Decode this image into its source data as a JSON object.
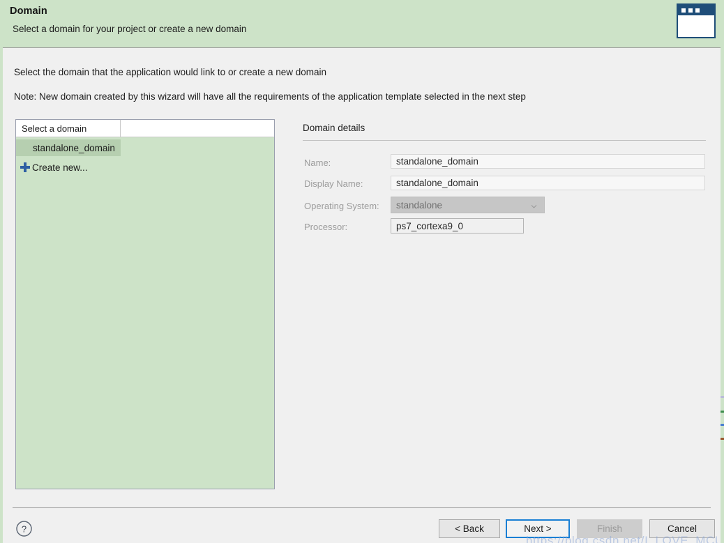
{
  "header": {
    "title": "Domain",
    "subtitle": "Select a domain for your project or create a new domain",
    "icon": "wizard-window-icon"
  },
  "instructions": {
    "line1": "Select the domain that the application would link to or create a new domain",
    "line2": "Note: New domain created by this wizard will have all the requirements of the application template selected in the next step"
  },
  "domain_list": {
    "columns": [
      "Select a domain",
      ""
    ],
    "rows": [
      {
        "label": "standalone_domain",
        "selected": true
      },
      {
        "label": "Create new...",
        "icon": "plus-icon",
        "selected": false
      }
    ]
  },
  "details": {
    "title": "Domain details",
    "fields": [
      {
        "label": "Name:",
        "value": "standalone_domain",
        "type": "text",
        "enabled": true
      },
      {
        "label": "Display Name:",
        "value": "standalone_domain",
        "type": "text",
        "enabled": true
      },
      {
        "label": "Operating System:",
        "value": "standalone",
        "type": "combo",
        "enabled": false
      },
      {
        "label": "Processor:",
        "value": "ps7_cortexa9_0",
        "type": "text",
        "enabled": true
      }
    ]
  },
  "footer": {
    "help_icon": "question-mark-icon",
    "buttons": [
      {
        "label": "< Back",
        "state": "enabled"
      },
      {
        "label": "Next >",
        "state": "focused"
      },
      {
        "label": "Finish",
        "state": "disabled"
      },
      {
        "label": "Cancel",
        "state": "enabled"
      }
    ],
    "watermark": "https://blog.csdn.net/I_LOVE_MCU"
  },
  "colors": {
    "header_bg": "#cde3c8",
    "dialog_bg": "#f0f0f0",
    "list_bg": "#cde3c8",
    "selection": "#b6cfb0",
    "focus_border": "#1a7fd4",
    "icon_blue": "#1f4e79",
    "plus_blue": "#2e5fa3"
  }
}
